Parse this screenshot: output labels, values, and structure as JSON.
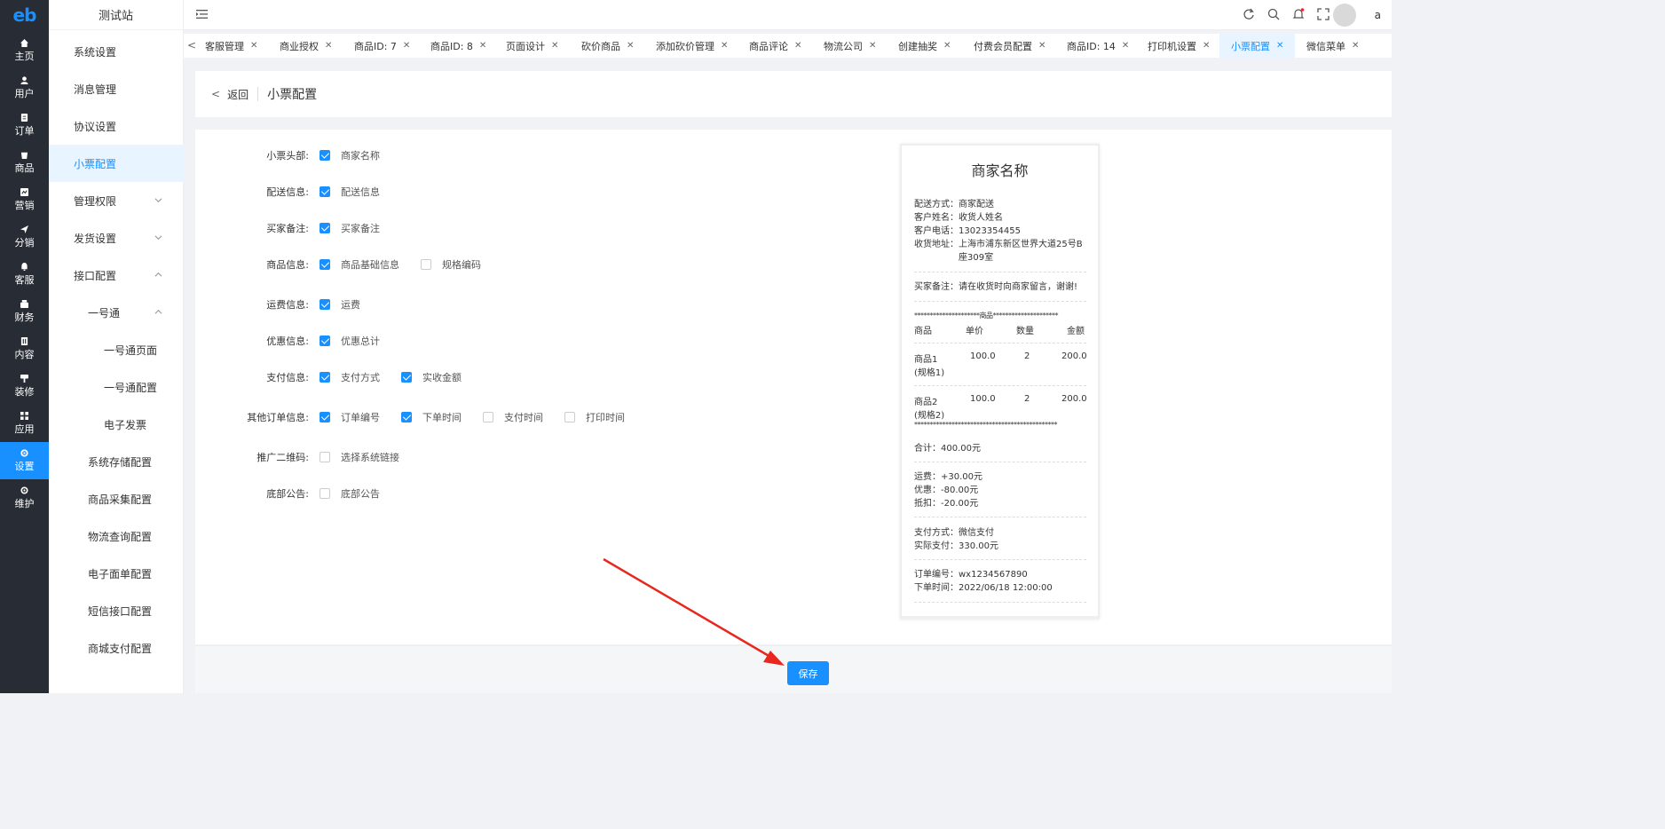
{
  "rail": {
    "logo": "eb",
    "items": [
      {
        "label": "主页",
        "icon": "home-icon"
      },
      {
        "label": "用户",
        "icon": "user-icon"
      },
      {
        "label": "订单",
        "icon": "order-icon"
      },
      {
        "label": "商品",
        "icon": "product-icon"
      },
      {
        "label": "营销",
        "icon": "marketing-icon"
      },
      {
        "label": "分销",
        "icon": "distribution-icon"
      },
      {
        "label": "客服",
        "icon": "service-icon"
      },
      {
        "label": "财务",
        "icon": "finance-icon"
      },
      {
        "label": "内容",
        "icon": "content-icon"
      },
      {
        "label": "装修",
        "icon": "decorate-icon"
      },
      {
        "label": "应用",
        "icon": "apps-icon"
      },
      {
        "label": "设置",
        "icon": "settings-icon",
        "active": true
      },
      {
        "label": "维护",
        "icon": "maintenance-icon"
      }
    ]
  },
  "submenu": {
    "site_name": "测试站",
    "items": [
      {
        "label": "系统设置"
      },
      {
        "label": "消息管理"
      },
      {
        "label": "协议设置"
      },
      {
        "label": "小票配置",
        "active": true
      },
      {
        "label": "管理权限",
        "chevron": "down"
      },
      {
        "label": "发货设置",
        "chevron": "down"
      },
      {
        "label": "接口配置",
        "chevron": "up"
      },
      {
        "label": "一号通",
        "chevron": "up"
      },
      {
        "label": "一号通页面"
      },
      {
        "label": "一号通配置"
      },
      {
        "label": "电子发票"
      },
      {
        "label": "系统存储配置"
      },
      {
        "label": "商品采集配置"
      },
      {
        "label": "物流查询配置"
      },
      {
        "label": "电子面单配置"
      },
      {
        "label": "短信接口配置"
      },
      {
        "label": "商城支付配置"
      }
    ]
  },
  "header": {
    "user_name": "a"
  },
  "tabs": [
    {
      "label": "客服管理"
    },
    {
      "label": "商业授权"
    },
    {
      "label": "商品ID: 7"
    },
    {
      "label": "商品ID: 8"
    },
    {
      "label": "页面设计"
    },
    {
      "label": "砍价商品"
    },
    {
      "label": "添加砍价管理"
    },
    {
      "label": "商品评论"
    },
    {
      "label": "物流公司"
    },
    {
      "label": "创建抽奖"
    },
    {
      "label": "付费会员配置"
    },
    {
      "label": "商品ID: 14"
    },
    {
      "label": "打印机设置"
    },
    {
      "label": "小票配置",
      "active": true
    },
    {
      "label": "微信菜单"
    }
  ],
  "page": {
    "back_label": "返回",
    "title": "小票配置"
  },
  "form": {
    "rows": [
      {
        "label": "小票头部:",
        "options": [
          {
            "text": "商家名称",
            "checked": true
          }
        ]
      },
      {
        "label": "配送信息:",
        "options": [
          {
            "text": "配送信息",
            "checked": true
          }
        ]
      },
      {
        "label": "买家备注:",
        "options": [
          {
            "text": "买家备注",
            "checked": true
          }
        ]
      },
      {
        "label": "商品信息:",
        "options": [
          {
            "text": "商品基础信息",
            "checked": true
          },
          {
            "text": "规格编码",
            "checked": false
          }
        ]
      },
      {
        "label": "运费信息:",
        "options": [
          {
            "text": "运费",
            "checked": true
          }
        ]
      },
      {
        "label": "优惠信息:",
        "options": [
          {
            "text": "优惠总计",
            "checked": true
          }
        ]
      },
      {
        "label": "支付信息:",
        "options": [
          {
            "text": "支付方式",
            "checked": true
          },
          {
            "text": "实收金额",
            "checked": true
          }
        ]
      },
      {
        "label": "其他订单信息:",
        "options": [
          {
            "text": "订单编号",
            "checked": true
          },
          {
            "text": "下单时间",
            "checked": true
          },
          {
            "text": "支付时间",
            "checked": false
          },
          {
            "text": "打印时间",
            "checked": false
          }
        ]
      },
      {
        "label": "推广二维码:",
        "options": [
          {
            "text": "选择系统链接",
            "checked": false
          }
        ]
      },
      {
        "label": "底部公告:",
        "options": [
          {
            "text": "底部公告",
            "checked": false
          }
        ]
      }
    ]
  },
  "receipt": {
    "title": "商家名称",
    "delivery_method": "配送方式：商家配送",
    "customer_name": "客户姓名：收货人姓名",
    "customer_phone": "客户电话：13023354455",
    "address_label": "收货地址：",
    "address_line1": "上海市浦东新区世界大道25号B",
    "address_line2": "座309室",
    "buyer_note": "买家备注：请在收货时向商家留言，谢谢!",
    "goods_divider": "*********************商品*********************",
    "headers": [
      "商品",
      "单价",
      "数量",
      "金额"
    ],
    "items": [
      {
        "name": "商品1",
        "spec": "(规格1)",
        "price": "100.0",
        "qty": "2",
        "amount": "200.0"
      },
      {
        "name": "商品2",
        "spec": "(规格2)",
        "price": "100.0",
        "qty": "2",
        "amount": "200.0"
      }
    ],
    "end_divider": "**********************************************",
    "total": "合计：400.00元",
    "freight": "运费：+30.00元",
    "discount": "优惠：-80.00元",
    "deduction": "抵扣：-20.00元",
    "pay_method": "支付方式：微信支付",
    "paid": "实际支付：330.00元",
    "order_no": "订单编号：wx1234567890",
    "order_time": "下单时间：2022/06/18 12:00:00"
  },
  "footer": {
    "save_label": "保存"
  },
  "colors": {
    "accent": "#1890ff",
    "rail_bg": "#282c34",
    "arrow": "#e8281e"
  }
}
